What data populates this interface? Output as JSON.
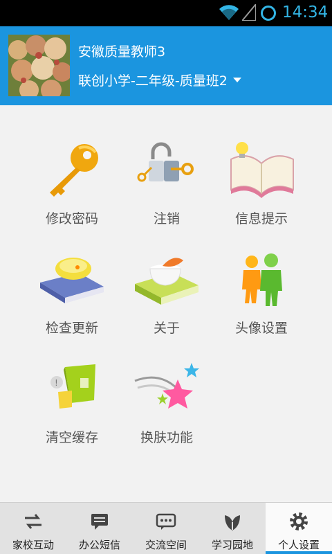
{
  "status_bar": {
    "time": "14:34",
    "accent": "#33b5e5"
  },
  "header": {
    "teacher_name": "安徽质量教师3",
    "class_name": "联创小学-二年级-质量班2",
    "background": "#1b95df"
  },
  "menu": [
    {
      "label": "修改密码",
      "icon": "key-icon"
    },
    {
      "label": "注销",
      "icon": "lock-key-icon"
    },
    {
      "label": "信息提示",
      "icon": "book-bulb-icon"
    },
    {
      "label": "检查更新",
      "icon": "mouse-book-icon"
    },
    {
      "label": "关于",
      "icon": "tea-cup-icon"
    },
    {
      "label": "头像设置",
      "icon": "people-icon"
    },
    {
      "label": "清空缓存",
      "icon": "trash-bin-icon"
    },
    {
      "label": "换肤功能",
      "icon": "stars-icon"
    }
  ],
  "bottom_nav": [
    {
      "label": "家校互动",
      "icon": "arrows-swap-icon",
      "active": false
    },
    {
      "label": "办公短信",
      "icon": "chat-bubble-icon",
      "active": false
    },
    {
      "label": "交流空间",
      "icon": "comment-dots-icon",
      "active": false
    },
    {
      "label": "学习园地",
      "icon": "leaf-icon",
      "active": false
    },
    {
      "label": "个人设置",
      "icon": "gear-icon",
      "active": true
    }
  ]
}
